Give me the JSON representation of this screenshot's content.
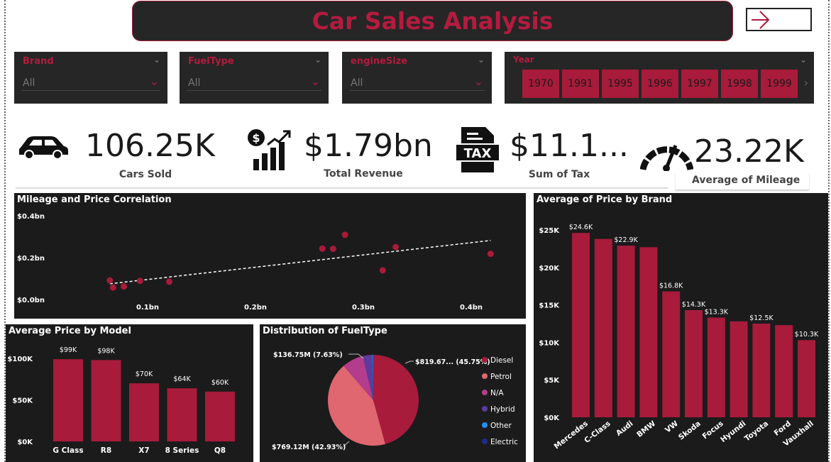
{
  "header": {
    "title": "Car Sales Analysis"
  },
  "slicers": {
    "brand": {
      "label": "Brand",
      "value": "All"
    },
    "fuel": {
      "label": "FuelType",
      "value": "All"
    },
    "engine": {
      "label": "engineSize",
      "value": "All"
    },
    "year": {
      "label": "Year",
      "chips": [
        "1970",
        "1991",
        "1995",
        "1996",
        "1997",
        "1998",
        "1999"
      ]
    }
  },
  "kpis": {
    "cars": {
      "value": "106.25K",
      "label": "Cars Sold"
    },
    "revenue": {
      "value": "$1.79bn",
      "label": "Total Revenue"
    },
    "tax": {
      "value": "$11.1...",
      "label": "Sum of Tax"
    },
    "mileage": {
      "value": "23.22K",
      "label": "Average of Mileage"
    }
  },
  "colors": {
    "primary": "#a81b3a",
    "panel": "#1b1b1b",
    "petrol": "#e0676f",
    "na": "#b43c8c",
    "hybrid": "#5b3c9e",
    "other": "#1e90ff",
    "electric": "#1f2a8a"
  },
  "chart_data": [
    {
      "type": "scatter",
      "title": "Mileage and Price Correlation",
      "ylim": [
        0,
        0.4
      ],
      "xlim": [
        0,
        0.45
      ],
      "y_ticks": [
        "$0.0bn",
        "$0.2bn",
        "$0.4bn"
      ],
      "x_ticks": [
        "0.1bn",
        "0.2bn",
        "0.3bn",
        "0.4bn"
      ],
      "points": [
        {
          "x": 0.065,
          "y": 0.091
        },
        {
          "x": 0.068,
          "y": 0.057
        },
        {
          "x": 0.078,
          "y": 0.062
        },
        {
          "x": 0.093,
          "y": 0.089
        },
        {
          "x": 0.12,
          "y": 0.085
        },
        {
          "x": 0.262,
          "y": 0.243
        },
        {
          "x": 0.272,
          "y": 0.242
        },
        {
          "x": 0.283,
          "y": 0.309
        },
        {
          "x": 0.318,
          "y": 0.139
        },
        {
          "x": 0.33,
          "y": 0.25
        },
        {
          "x": 0.418,
          "y": 0.218
        }
      ],
      "trend": [
        {
          "x": 0.065,
          "y": 0.075
        },
        {
          "x": 0.418,
          "y": 0.282
        }
      ]
    },
    {
      "type": "bar",
      "title": "Average of Price by Brand",
      "categories": [
        "Mercedes",
        "C-Class",
        "Audi",
        "BMW",
        "VW",
        "Skoda",
        "Focus",
        "Hyundi",
        "Toyota",
        "Ford",
        "Vauxhall"
      ],
      "values": [
        24.6,
        23.8,
        22.9,
        22.7,
        16.8,
        14.3,
        13.3,
        12.8,
        12.5,
        12.3,
        10.3
      ],
      "labels": [
        "$24.6K",
        "",
        "$22.9K",
        "",
        "$16.8K",
        "$14.3K",
        "$13.3K",
        "",
        "$12.5K",
        "",
        "$10.3K"
      ],
      "ylim": [
        0,
        25
      ],
      "y_ticks": [
        "$0K",
        "$5K",
        "$10K",
        "$15K",
        "$20K",
        "$25K"
      ]
    },
    {
      "type": "bar",
      "title": "Average Price by Model",
      "categories": [
        "G Class",
        "R8",
        "X7",
        "8 Series",
        "Q8"
      ],
      "values": [
        99,
        98,
        70,
        64,
        60
      ],
      "labels": [
        "$99K",
        "$98K",
        "$70K",
        "$64K",
        "$60K"
      ],
      "ylim": [
        0,
        100
      ],
      "y_ticks": [
        "$0K",
        "$50K",
        "$100K"
      ]
    },
    {
      "type": "pie",
      "title": "Distribution of FuelType",
      "slices": [
        {
          "name": "Diesel",
          "value": 45.75,
          "label": "$819.67... (45.75%)"
        },
        {
          "name": "Petrol",
          "value": 42.93,
          "label": "$769.12M (42.93%)"
        },
        {
          "name": "N/A",
          "value": 7.63,
          "label": "$136.75M (7.63%)"
        },
        {
          "name": "Hybrid",
          "value": 3.3,
          "label": ""
        },
        {
          "name": "Other",
          "value": 0.3,
          "label": ""
        },
        {
          "name": "Electric",
          "value": 0.09,
          "label": ""
        }
      ]
    }
  ]
}
